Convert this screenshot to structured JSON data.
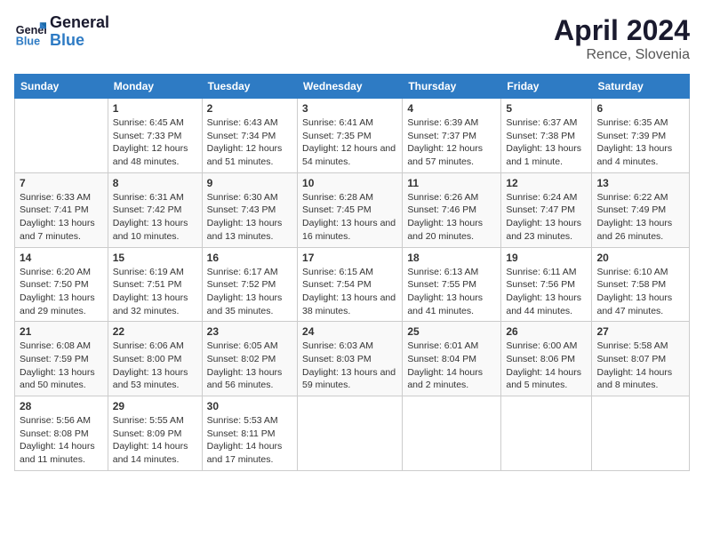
{
  "header": {
    "logo_line1": "General",
    "logo_line2": "Blue",
    "month": "April 2024",
    "location": "Rence, Slovenia"
  },
  "weekdays": [
    "Sunday",
    "Monday",
    "Tuesday",
    "Wednesday",
    "Thursday",
    "Friday",
    "Saturday"
  ],
  "weeks": [
    [
      {
        "day": null
      },
      {
        "day": "1",
        "sunrise": "6:45 AM",
        "sunset": "7:33 PM",
        "daylight": "12 hours and 48 minutes."
      },
      {
        "day": "2",
        "sunrise": "6:43 AM",
        "sunset": "7:34 PM",
        "daylight": "12 hours and 51 minutes."
      },
      {
        "day": "3",
        "sunrise": "6:41 AM",
        "sunset": "7:35 PM",
        "daylight": "12 hours and 54 minutes."
      },
      {
        "day": "4",
        "sunrise": "6:39 AM",
        "sunset": "7:37 PM",
        "daylight": "12 hours and 57 minutes."
      },
      {
        "day": "5",
        "sunrise": "6:37 AM",
        "sunset": "7:38 PM",
        "daylight": "13 hours and 1 minute."
      },
      {
        "day": "6",
        "sunrise": "6:35 AM",
        "sunset": "7:39 PM",
        "daylight": "13 hours and 4 minutes."
      }
    ],
    [
      {
        "day": "7",
        "sunrise": "6:33 AM",
        "sunset": "7:41 PM",
        "daylight": "13 hours and 7 minutes."
      },
      {
        "day": "8",
        "sunrise": "6:31 AM",
        "sunset": "7:42 PM",
        "daylight": "13 hours and 10 minutes."
      },
      {
        "day": "9",
        "sunrise": "6:30 AM",
        "sunset": "7:43 PM",
        "daylight": "13 hours and 13 minutes."
      },
      {
        "day": "10",
        "sunrise": "6:28 AM",
        "sunset": "7:45 PM",
        "daylight": "13 hours and 16 minutes."
      },
      {
        "day": "11",
        "sunrise": "6:26 AM",
        "sunset": "7:46 PM",
        "daylight": "13 hours and 20 minutes."
      },
      {
        "day": "12",
        "sunrise": "6:24 AM",
        "sunset": "7:47 PM",
        "daylight": "13 hours and 23 minutes."
      },
      {
        "day": "13",
        "sunrise": "6:22 AM",
        "sunset": "7:49 PM",
        "daylight": "13 hours and 26 minutes."
      }
    ],
    [
      {
        "day": "14",
        "sunrise": "6:20 AM",
        "sunset": "7:50 PM",
        "daylight": "13 hours and 29 minutes."
      },
      {
        "day": "15",
        "sunrise": "6:19 AM",
        "sunset": "7:51 PM",
        "daylight": "13 hours and 32 minutes."
      },
      {
        "day": "16",
        "sunrise": "6:17 AM",
        "sunset": "7:52 PM",
        "daylight": "13 hours and 35 minutes."
      },
      {
        "day": "17",
        "sunrise": "6:15 AM",
        "sunset": "7:54 PM",
        "daylight": "13 hours and 38 minutes."
      },
      {
        "day": "18",
        "sunrise": "6:13 AM",
        "sunset": "7:55 PM",
        "daylight": "13 hours and 41 minutes."
      },
      {
        "day": "19",
        "sunrise": "6:11 AM",
        "sunset": "7:56 PM",
        "daylight": "13 hours and 44 minutes."
      },
      {
        "day": "20",
        "sunrise": "6:10 AM",
        "sunset": "7:58 PM",
        "daylight": "13 hours and 47 minutes."
      }
    ],
    [
      {
        "day": "21",
        "sunrise": "6:08 AM",
        "sunset": "7:59 PM",
        "daylight": "13 hours and 50 minutes."
      },
      {
        "day": "22",
        "sunrise": "6:06 AM",
        "sunset": "8:00 PM",
        "daylight": "13 hours and 53 minutes."
      },
      {
        "day": "23",
        "sunrise": "6:05 AM",
        "sunset": "8:02 PM",
        "daylight": "13 hours and 56 minutes."
      },
      {
        "day": "24",
        "sunrise": "6:03 AM",
        "sunset": "8:03 PM",
        "daylight": "13 hours and 59 minutes."
      },
      {
        "day": "25",
        "sunrise": "6:01 AM",
        "sunset": "8:04 PM",
        "daylight": "14 hours and 2 minutes."
      },
      {
        "day": "26",
        "sunrise": "6:00 AM",
        "sunset": "8:06 PM",
        "daylight": "14 hours and 5 minutes."
      },
      {
        "day": "27",
        "sunrise": "5:58 AM",
        "sunset": "8:07 PM",
        "daylight": "14 hours and 8 minutes."
      }
    ],
    [
      {
        "day": "28",
        "sunrise": "5:56 AM",
        "sunset": "8:08 PM",
        "daylight": "14 hours and 11 minutes."
      },
      {
        "day": "29",
        "sunrise": "5:55 AM",
        "sunset": "8:09 PM",
        "daylight": "14 hours and 14 minutes."
      },
      {
        "day": "30",
        "sunrise": "5:53 AM",
        "sunset": "8:11 PM",
        "daylight": "14 hours and 17 minutes."
      },
      {
        "day": null
      },
      {
        "day": null
      },
      {
        "day": null
      },
      {
        "day": null
      }
    ]
  ]
}
